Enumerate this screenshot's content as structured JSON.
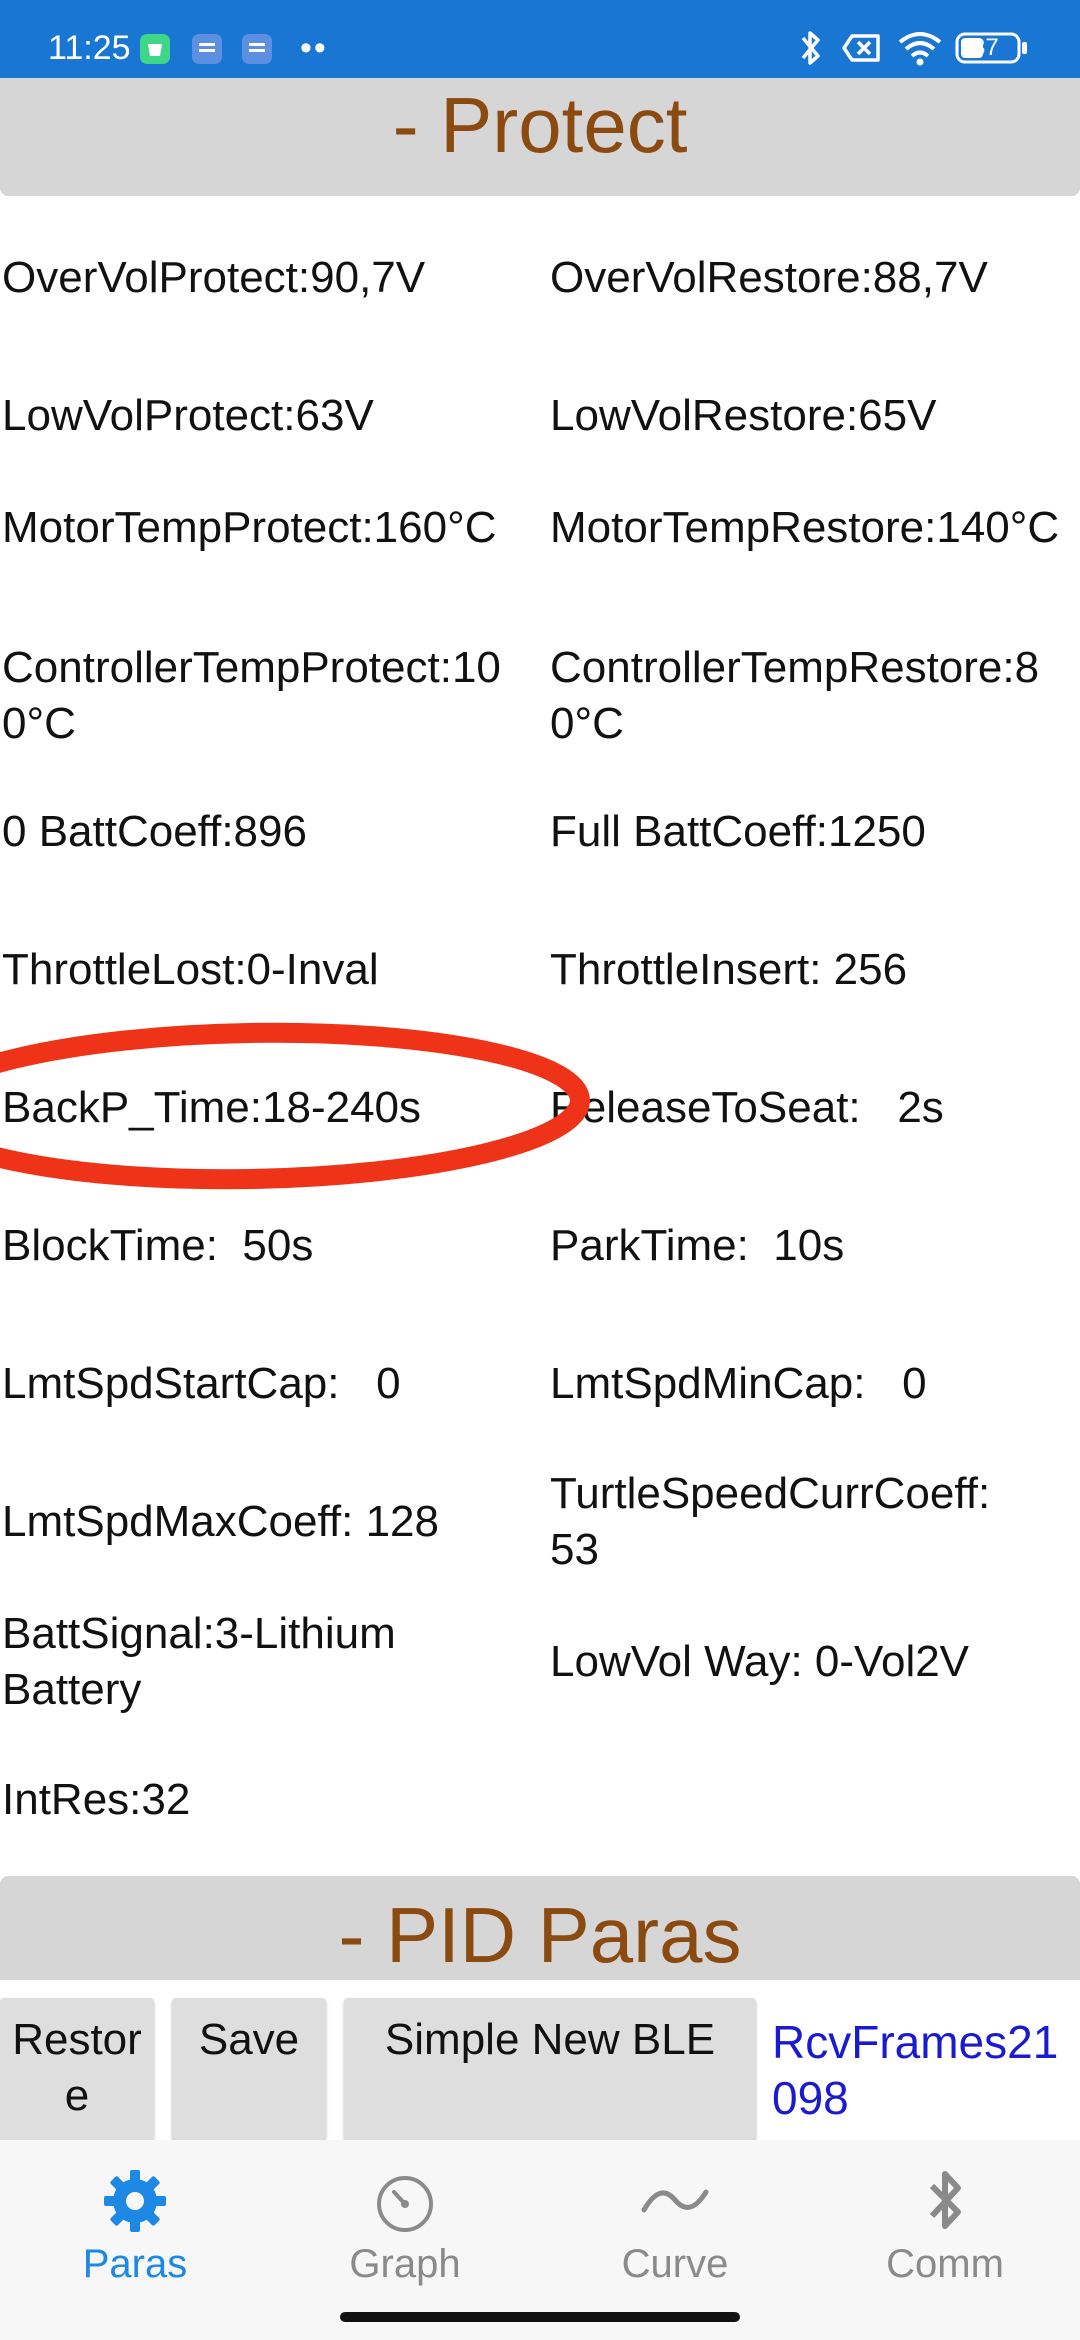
{
  "status_bar": {
    "time": "11:25",
    "dots": "••",
    "battery": "37",
    "icons": [
      "app-notification-icon",
      "message-icon",
      "message-icon",
      "bluetooth-icon",
      "sim-off-icon",
      "wifi-icon",
      "battery-icon"
    ],
    "background": "#1976d2"
  },
  "sections": {
    "protect_title": "- Protect",
    "pid_title": "- PID Paras"
  },
  "params": {
    "r1_left": "OverVolProtect:90,7V",
    "r1_right": "OverVolRestore:88,7V",
    "r2_left": "LowVolProtect:63V",
    "r2_right": "LowVolRestore:65V",
    "r3_left": "MotorTempProtect:160°C",
    "r3_right": "MotorTempRestore:140°C",
    "r4_left": "ControllerTempProtect:100°C",
    "r4_right": "ControllerTempRestore:80°C",
    "r5_left": "0 BattCoeff:896",
    "r5_right": "Full BattCoeff:1250",
    "r6_left": "ThrottleLost:0-Inval",
    "r6_right": "ThrottleInsert: 256",
    "r7_left": "BackP_Time:18-240s",
    "r7_right": "ReleaseToSeat:   2s",
    "r8_left": "BlockTime:  50s",
    "r8_right": "ParkTime:  10s",
    "r9_left": "LmtSpdStartCap:   0",
    "r9_right": "LmtSpdMinCap:   0",
    "r10_left": "LmtSpdMaxCoeff: 128",
    "r10_right": "TurtleSpeedCurrCoeff: 53",
    "r11_left": "BattSignal:3-Lithium Battery",
    "r11_right": "LowVol Way: 0-Vol2V",
    "r12_left": "IntRes:32"
  },
  "actions": {
    "restore": "Restore",
    "save": "Save",
    "simple_new_ble": "Simple New BLE",
    "rcv_frames": "RcvFrames21098"
  },
  "nav": {
    "paras": "Paras",
    "graph": "Graph",
    "curve": "Curve",
    "comm": "Comm",
    "active": "Paras",
    "active_color": "#1e88e5",
    "inactive_color": "#8a8a8a"
  },
  "colors": {
    "section_title": "#8b4a10",
    "section_bg": "#d6d6d6",
    "rcv_text": "#1a1ad0",
    "annotation": "#ee3318"
  }
}
